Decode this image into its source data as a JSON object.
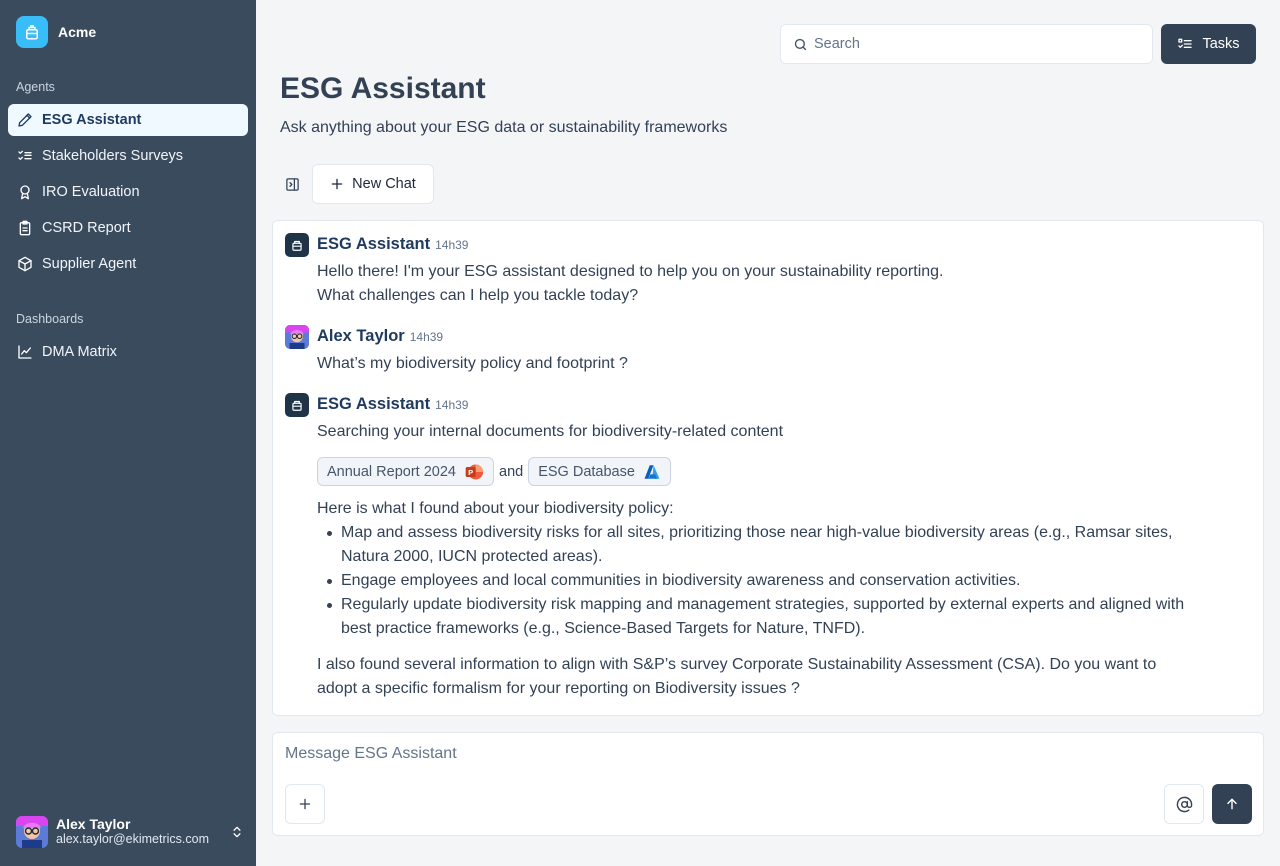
{
  "brand": {
    "name": "Acme"
  },
  "sidebar": {
    "agents_label": "Agents",
    "agents": [
      {
        "label": "ESG Assistant",
        "icon": "pencil-icon",
        "active": true
      },
      {
        "label": "Stakeholders Surveys",
        "icon": "checklist-icon"
      },
      {
        "label": "IRO Evaluation",
        "icon": "award-icon"
      },
      {
        "label": "CSRD Report",
        "icon": "clipboard-icon"
      },
      {
        "label": "Supplier Agent",
        "icon": "package-icon"
      }
    ],
    "dashboards_label": "Dashboards",
    "dashboards": [
      {
        "label": "DMA Matrix",
        "icon": "line-chart-icon"
      }
    ]
  },
  "user": {
    "name": "Alex Taylor",
    "email": "alex.taylor@ekimetrics.com"
  },
  "header": {
    "search_placeholder": "Search",
    "tasks_label": "Tasks",
    "title": "ESG Assistant",
    "subtitle": "Ask anything about your ESG data or sustainability frameworks"
  },
  "toolbar": {
    "new_chat_label": "New Chat"
  },
  "messages": [
    {
      "author": "ESG Assistant",
      "time": "14h39",
      "lines": [
        "Hello there! I'm your ESG assistant designed to help you on your sustainability reporting.",
        "What challenges can I help you tackle today?"
      ]
    },
    {
      "author": "Alex Taylor",
      "time": "14h39",
      "text": "What’s my biodiversity policy and footprint ?"
    },
    {
      "author": "ESG Assistant",
      "time": "14h39",
      "searching": "Searching your internal documents for biodiversity-related content",
      "sources": [
        {
          "label": "Annual Report 2024",
          "icon": "powerpoint-icon"
        },
        {
          "label": "ESG Database",
          "icon": "azure-icon"
        }
      ],
      "sources_joiner": "and",
      "intro": "Here is what I found about your biodiversity policy:",
      "bullets": [
        "Map and assess biodiversity risks for all sites, prioritizing those near high-value biodiversity areas (e.g., Ramsar sites, Natura 2000, IUCN protected areas).",
        "Engage employees and local communities in biodiversity awareness and conservation activities.",
        "Regularly update biodiversity risk mapping and management strategies, supported by external experts and aligned with best practice frameworks (e.g., Science-Based Targets for Nature, TNFD)."
      ],
      "outro": "I also found several information to align with S&P’s survey Corporate Sustainability Assessment (CSA). Do you want to adopt a specific formalism for your reporting on Biodiversity issues ?"
    }
  ],
  "composer": {
    "placeholder": "Message ESG Assistant"
  },
  "colors": {
    "sidebar": "#3a4b5e",
    "accent": "#38bdf8",
    "primary_button": "#334155",
    "active_nav_bg": "#f0f9ff"
  }
}
